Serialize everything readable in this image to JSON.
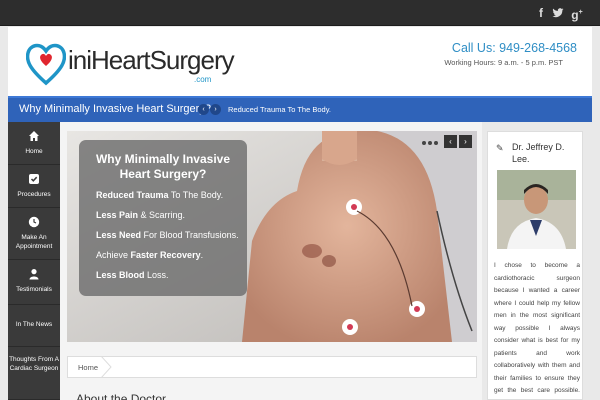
{
  "topbar": {
    "social": [
      "facebook-icon",
      "twitter-icon",
      "google-plus-icon"
    ]
  },
  "header": {
    "logo": {
      "text1": "ini",
      "text2": "Heart",
      "text3": "Surgery",
      "suffix": ".com"
    },
    "call": "Call Us: 949-268-4568",
    "hours": "Working Hours: 9 a.m. - 5 p.m. PST"
  },
  "bluebar": {
    "title": "Why Minimally Invasive Heart Surgery?",
    "ticker": "Reduced Trauma To The Body."
  },
  "nav": {
    "items": [
      {
        "label": "Home",
        "icon": "home-icon"
      },
      {
        "label": "Procedures",
        "icon": "checkbox-icon"
      },
      {
        "label": "Make An Appointment",
        "icon": "clock-icon"
      },
      {
        "label": "Testimonials",
        "icon": "user-icon"
      },
      {
        "label": "In The News",
        "icon": ""
      },
      {
        "label": "Thoughts From A Cardiac Surgeon",
        "icon": ""
      }
    ]
  },
  "slider": {
    "title": "Why Minimally Invasive Heart Surgery?",
    "lines": [
      {
        "bold": "Reduced Trauma",
        "rest": " To The Body."
      },
      {
        "bold": "Less Pain",
        "rest": " & Scarring."
      },
      {
        "bold": "Less Need",
        "rest": " For Blood Transfusions."
      },
      {
        "pre": "Achieve ",
        "bold": "Faster Recovery",
        "rest": "."
      },
      {
        "bold": "Less Blood",
        "rest": " Loss."
      }
    ]
  },
  "breadcrumb": {
    "home": "Home"
  },
  "main": {
    "heading": "About the Doctor"
  },
  "bio": {
    "name": "Dr. Jeffrey D. Lee.",
    "text": "I chose to become a cardiothoracic surgeon because I wanted a career where I could help my fellow men in the most significant way possible I always consider what is best for my patients and work collaboratively with them and their families to ensure they get the best care possible. My primary"
  },
  "colors": {
    "accent": "#2f63b9",
    "phone": "#2f8ec5",
    "nav": "#3a3a3a"
  }
}
